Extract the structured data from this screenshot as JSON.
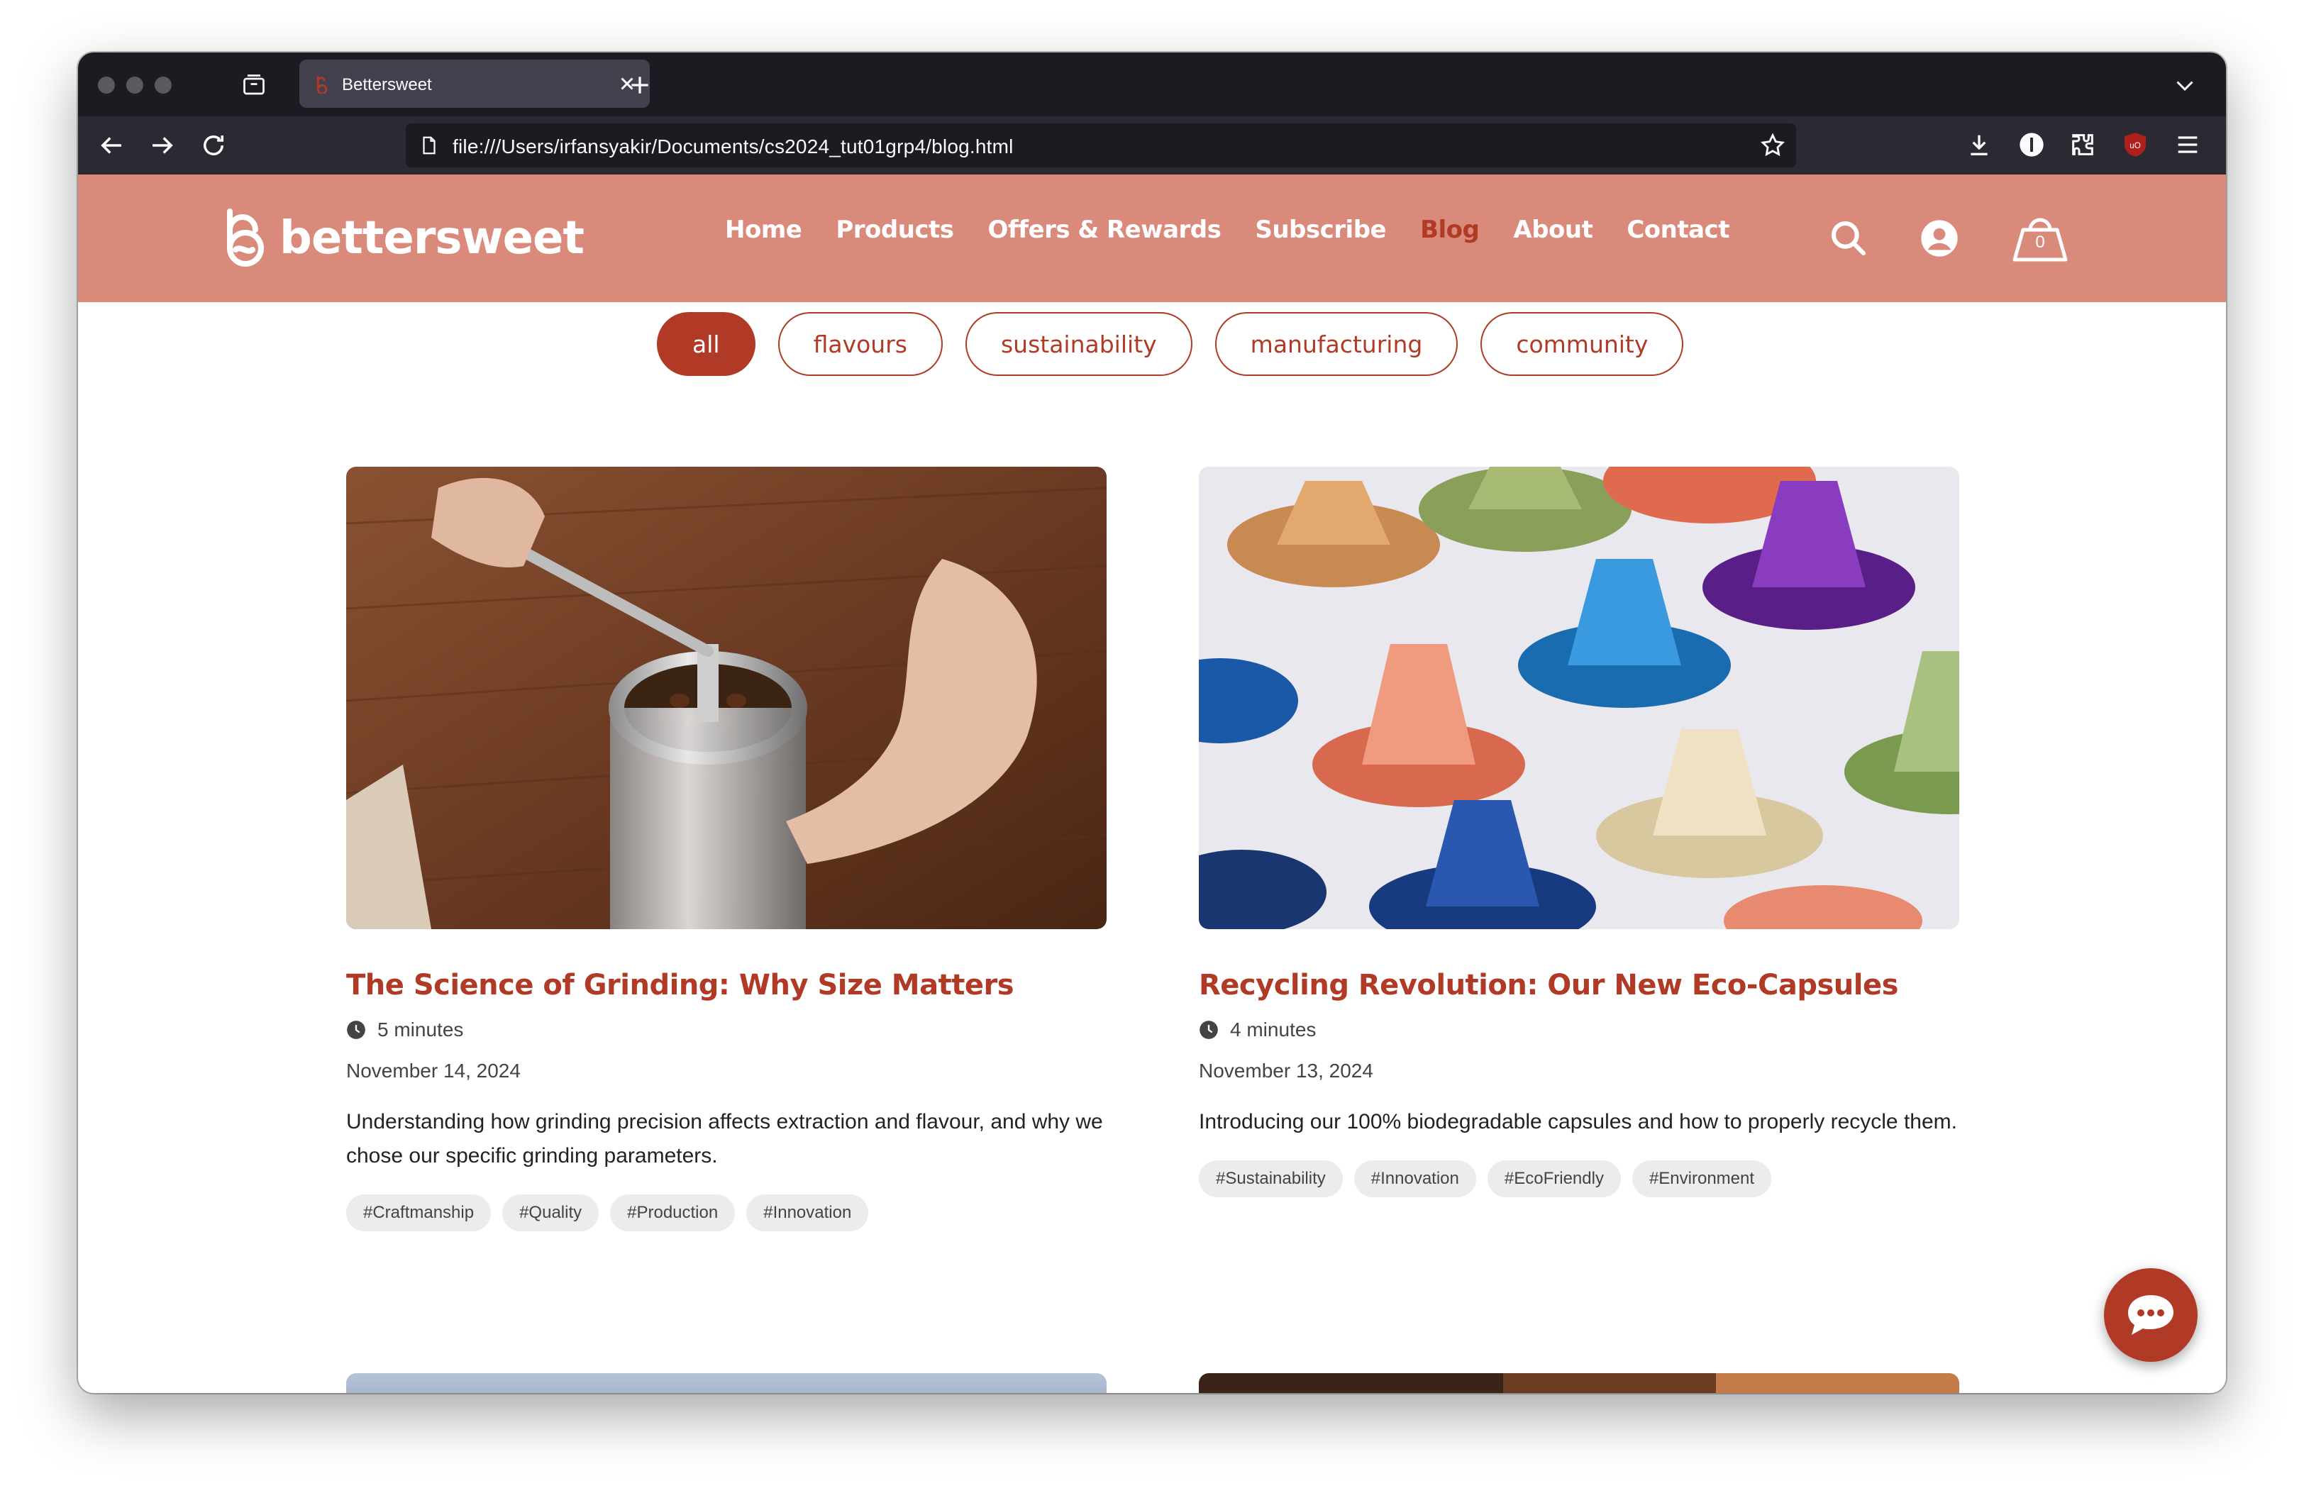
{
  "browser": {
    "tab_title": "Bettersweet",
    "url": "file:///Users/irfansyakir/Documents/cs2024_tut01grp4/blog.html"
  },
  "site": {
    "brand": "bettersweet",
    "nav": [
      {
        "label": "Home"
      },
      {
        "label": "Products"
      },
      {
        "label": "Offers & Rewards"
      },
      {
        "label": "Subscribe"
      },
      {
        "label": "Blog"
      },
      {
        "label": "About"
      },
      {
        "label": "Contact"
      }
    ],
    "active_nav": "Blog",
    "cart_count": "0"
  },
  "filters": [
    "all",
    "flavours",
    "sustainability",
    "manufacturing",
    "community"
  ],
  "active_filter": "all",
  "posts": [
    {
      "title": "The Science of Grinding: Why Size Matters",
      "read_time": "5 minutes",
      "date": "November 14, 2024",
      "description": "Understanding how grinding precision affects extraction and flavour, and why we chose our specific grinding parameters.",
      "tags": [
        "#Craftmanship",
        "#Quality",
        "#Production",
        "#Innovation"
      ]
    },
    {
      "title": "Recycling Revolution: Our New Eco-Capsules",
      "read_time": "4 minutes",
      "date": "November 13, 2024",
      "description": "Introducing our 100% biodegradable capsules and how to properly recycle them.",
      "tags": [
        "#Sustainability",
        "#Innovation",
        "#EcoFriendly",
        "#Environment"
      ]
    }
  ],
  "colors": {
    "brand_primary": "#b03a26",
    "header_bg": "#d98a7a",
    "chrome_dark": "#1c1b22",
    "chrome_toolbar": "#2b2a33"
  },
  "icons": {
    "chrome": [
      "tab-overview-icon",
      "favicon-icon",
      "close-icon",
      "plus-icon",
      "chevron-down-icon",
      "back-icon",
      "forward-icon",
      "reload-icon",
      "page-icon",
      "star-icon",
      "download-icon",
      "info-icon",
      "extensions-icon",
      "ublock-icon",
      "menu-icon"
    ],
    "site": [
      "logo-icon",
      "search-icon",
      "account-icon",
      "cart-icon",
      "clock-icon",
      "chat-icon"
    ]
  }
}
